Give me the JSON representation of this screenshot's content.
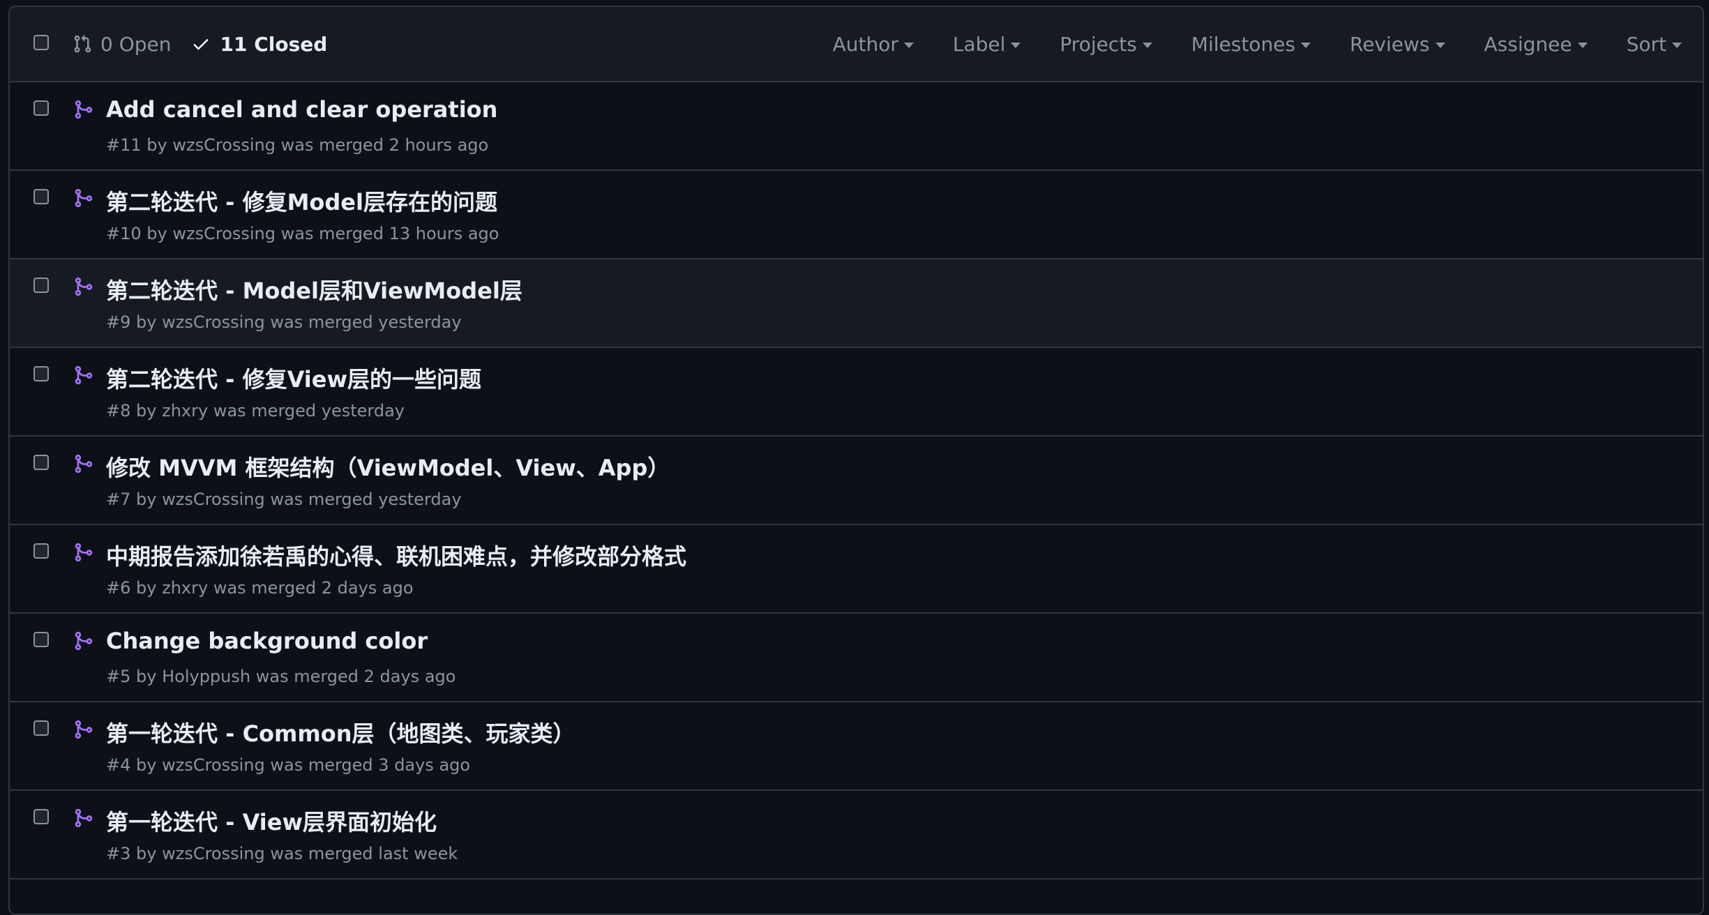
{
  "header": {
    "open_label": "0 Open",
    "closed_label": "11 Closed",
    "filters": [
      {
        "label": "Author"
      },
      {
        "label": "Label"
      },
      {
        "label": "Projects"
      },
      {
        "label": "Milestones"
      },
      {
        "label": "Reviews"
      },
      {
        "label": "Assignee"
      },
      {
        "label": "Sort"
      }
    ]
  },
  "pull_requests": [
    {
      "title": "Add cancel and clear operation",
      "number": "#11",
      "author": "wzsCrossing",
      "status": "was merged 2 hours ago"
    },
    {
      "title": "第二轮迭代 - 修复Model层存在的问题",
      "number": "#10",
      "author": "wzsCrossing",
      "status": "was merged 13 hours ago"
    },
    {
      "title": "第二轮迭代 - Model层和ViewModel层",
      "number": "#9",
      "author": "wzsCrossing",
      "status": "was merged yesterday"
    },
    {
      "title": "第二轮迭代 - 修复View层的一些问题",
      "number": "#8",
      "author": "zhxry",
      "status": "was merged yesterday"
    },
    {
      "title": "修改 MVVM 框架结构（ViewModel、View、App）",
      "number": "#7",
      "author": "wzsCrossing",
      "status": "was merged yesterday"
    },
    {
      "title": "中期报告添加徐若禹的心得、联机困难点，并修改部分格式",
      "number": "#6",
      "author": "zhxry",
      "status": "was merged 2 days ago"
    },
    {
      "title": "Change background color",
      "number": "#5",
      "author": "Holyppush",
      "status": "was merged 2 days ago"
    },
    {
      "title": "第一轮迭代 - Common层（地图类、玩家类）",
      "number": "#4",
      "author": "wzsCrossing",
      "status": "was merged 3 days ago"
    },
    {
      "title": "第一轮迭代 - View层界面初始化",
      "number": "#3",
      "author": "wzsCrossing",
      "status": "was merged last week"
    }
  ],
  "colors": {
    "background": "#0d1117",
    "header_bg": "#161b22",
    "border": "#30363d",
    "merged_icon": "#a371f7",
    "muted_text": "#8b949e",
    "primary_text": "#e6edf3"
  },
  "icons": {
    "open": "git-pull-request-icon",
    "closed": "check-icon",
    "merged": "git-merge-icon"
  }
}
